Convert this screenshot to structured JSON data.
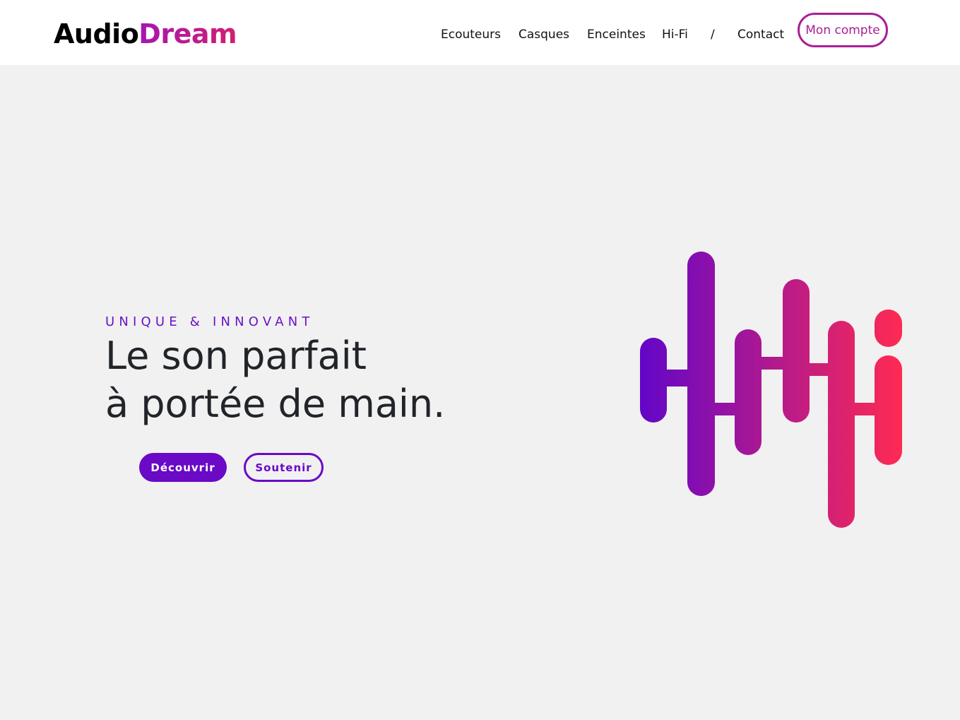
{
  "brand": {
    "part1": "Audio",
    "part2": "Dream"
  },
  "nav": {
    "items": [
      {
        "label": "Ecouteurs"
      },
      {
        "label": "Casques"
      },
      {
        "label": "Enceintes"
      },
      {
        "label": "Hi-Fi"
      },
      {
        "label": "/"
      },
      {
        "label": "Contact"
      }
    ],
    "account_label": "Mon compte"
  },
  "hero": {
    "eyebrow": "UNIQUE & INNOVANT",
    "headline_line1": "Le son parfait",
    "headline_line2": "à portée de main.",
    "primary_cta": "Découvrir",
    "secondary_cta": "Soutenir",
    "illustration_icon": "sound-wave-icon"
  },
  "colors": {
    "accent_purple": "#6a09c6",
    "accent_magenta": "#a81f96",
    "gradient_start": "#6306c8",
    "gradient_end": "#ff2a52",
    "hero_background": "#f1f1f1"
  }
}
